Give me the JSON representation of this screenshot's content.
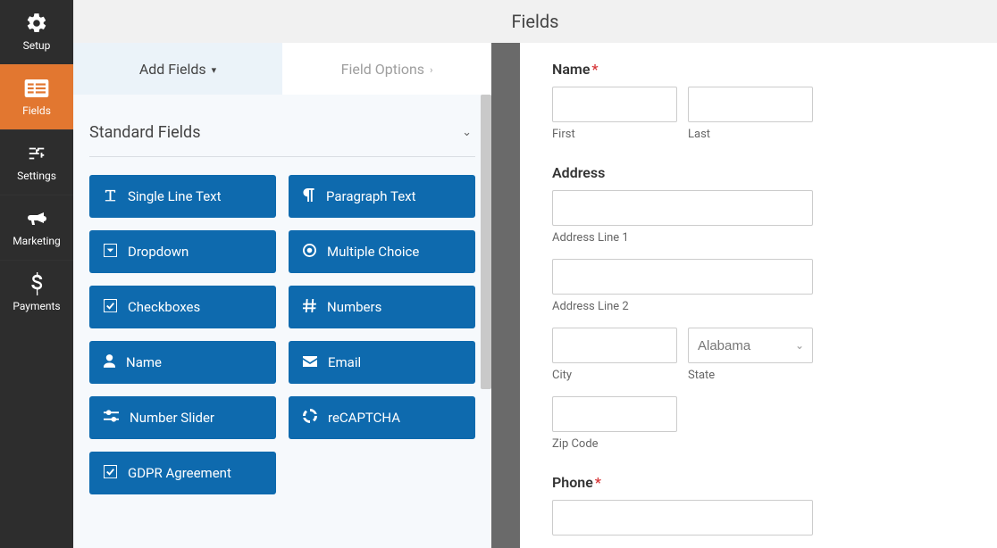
{
  "page_title": "Fields",
  "sidebar": {
    "items": [
      {
        "label": "Setup",
        "icon": "gear-icon"
      },
      {
        "label": "Fields",
        "icon": "list-icon"
      },
      {
        "label": "Settings",
        "icon": "sliders-icon"
      },
      {
        "label": "Marketing",
        "icon": "bullhorn-icon"
      },
      {
        "label": "Payments",
        "icon": "dollar-icon"
      }
    ],
    "active_index": 1
  },
  "tabs": {
    "add_fields": "Add Fields",
    "field_options": "Field Options"
  },
  "group": {
    "standard_title": "Standard Fields"
  },
  "field_buttons": [
    {
      "label": "Single Line Text",
      "icon": "text-icon"
    },
    {
      "label": "Paragraph Text",
      "icon": "paragraph-icon"
    },
    {
      "label": "Dropdown",
      "icon": "caret-square-icon"
    },
    {
      "label": "Multiple Choice",
      "icon": "radio-icon"
    },
    {
      "label": "Checkboxes",
      "icon": "check-square-icon"
    },
    {
      "label": "Numbers",
      "icon": "hash-icon"
    },
    {
      "label": "Name",
      "icon": "user-icon"
    },
    {
      "label": "Email",
      "icon": "envelope-icon"
    },
    {
      "label": "Number Slider",
      "icon": "slider-icon"
    },
    {
      "label": "reCAPTCHA",
      "icon": "recaptcha-icon"
    },
    {
      "label": "GDPR Agreement",
      "icon": "check-square-icon"
    }
  ],
  "preview": {
    "name_label": "Name",
    "name_required": "*",
    "first_sub": "First",
    "last_sub": "Last",
    "address_label": "Address",
    "addr1_sub": "Address Line 1",
    "addr2_sub": "Address Line 2",
    "city_sub": "City",
    "state_sub": "State",
    "state_value": "Alabama",
    "zip_sub": "Zip Code",
    "phone_label": "Phone",
    "phone_required": "*"
  }
}
